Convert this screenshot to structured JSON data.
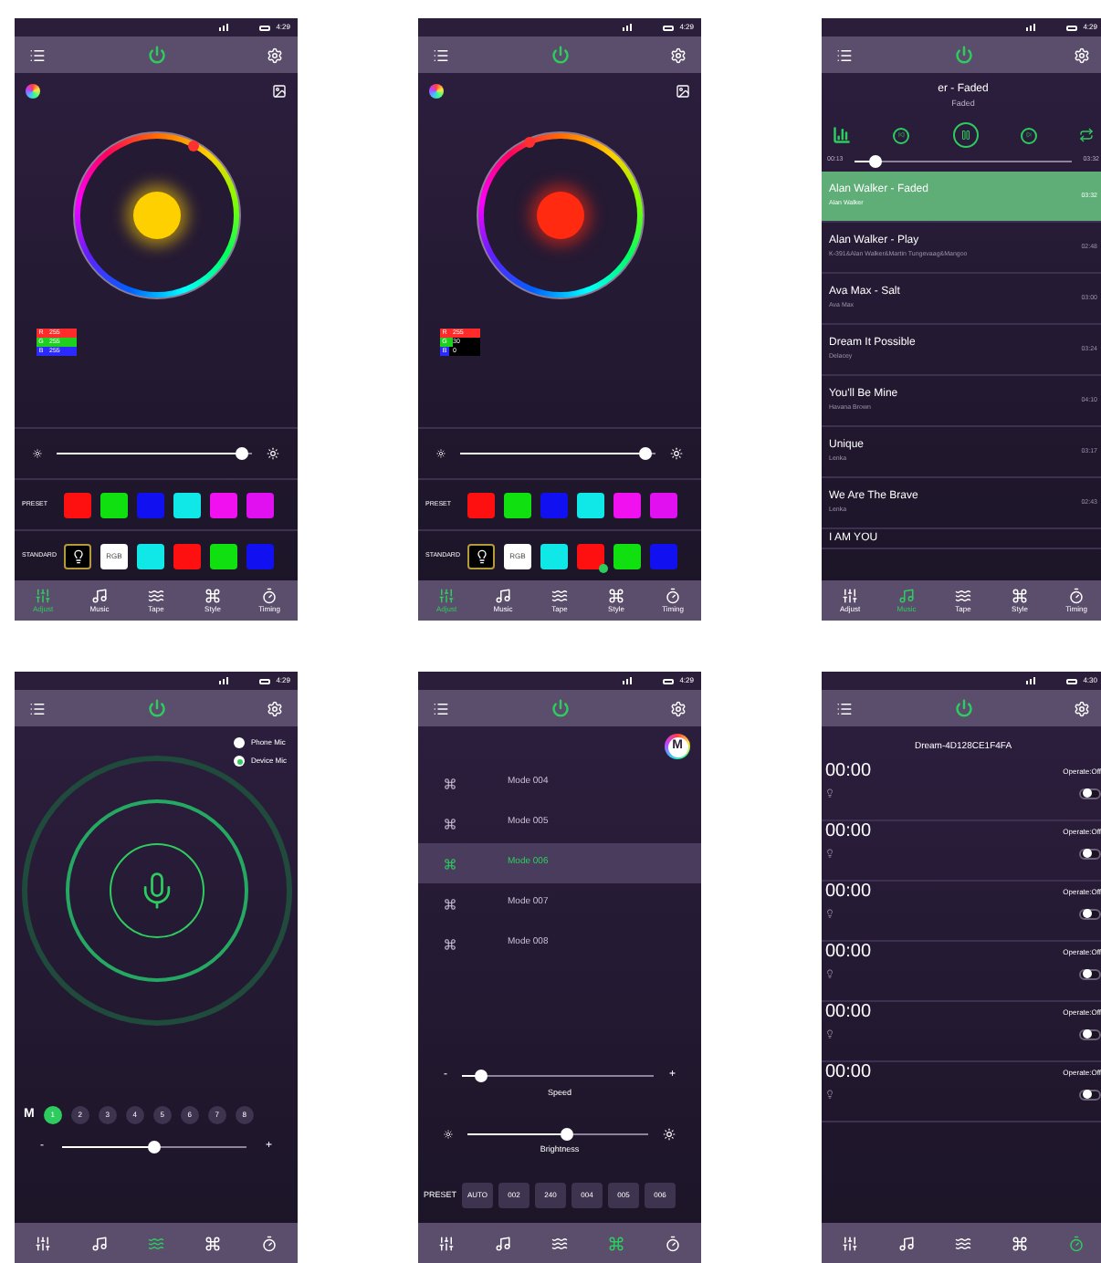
{
  "screens": [
    {
      "kind": "color",
      "status_bar": {
        "time": "4:29"
      },
      "wheel": {
        "color": "#ffd000"
      },
      "rgb": [
        {
          "label": "R",
          "value": "255",
          "level": 1,
          "color": "#ff2a2a"
        },
        {
          "label": "G",
          "value": "255",
          "level": 1,
          "color": "#1fcf1f"
        },
        {
          "label": "B",
          "value": "255",
          "level": 1,
          "color": "#2a2aff"
        }
      ],
      "brightness": {
        "level": 0.95
      },
      "preset": {
        "label": "PRESET",
        "swatches": [
          {
            "color": "#ff1010"
          },
          {
            "color": "#10e010"
          },
          {
            "color": "#1010f0"
          },
          {
            "color": "#10e8e8"
          },
          {
            "color": "#f010f0"
          },
          {
            "color": "#e010f0"
          }
        ]
      },
      "standard": {
        "label": "STANDARD",
        "items": [
          {
            "kind": "bulb",
            "selected": false
          },
          {
            "kind": "text",
            "text": "RGB",
            "selected": false
          },
          {
            "kind": "swatch",
            "color": "#10e8e8",
            "selected": false
          },
          {
            "kind": "swatch",
            "color": "#ff1010",
            "selected": false
          },
          {
            "kind": "swatch",
            "color": "#10e010",
            "selected": false
          },
          {
            "kind": "swatch",
            "color": "#1010f0",
            "selected": false
          }
        ]
      },
      "nav": [
        {
          "label": "Adjust",
          "selected": true
        },
        {
          "label": "Music",
          "selected": false
        },
        {
          "label": "Tape",
          "selected": false
        },
        {
          "label": "Style",
          "selected": false
        },
        {
          "label": "Timing",
          "selected": false
        }
      ]
    },
    {
      "kind": "color",
      "status_bar": {
        "time": "4:29"
      },
      "wheel": {
        "color": "#ff2a10"
      },
      "rgb": [
        {
          "label": "R",
          "value": "255",
          "level": 1,
          "color": "#ff2a2a"
        },
        {
          "label": "G",
          "value": "30",
          "level": 0.12,
          "color": "#1fcf1f"
        },
        {
          "label": "B",
          "value": "0",
          "level": 0,
          "color": "#2a2aff"
        }
      ],
      "brightness": {
        "level": 0.95
      },
      "preset": {
        "label": "PRESET",
        "swatches": [
          {
            "color": "#ff1010"
          },
          {
            "color": "#10e010"
          },
          {
            "color": "#1010f0"
          },
          {
            "color": "#10e8e8"
          },
          {
            "color": "#f010f0"
          },
          {
            "color": "#e010f0"
          }
        ]
      },
      "standard": {
        "label": "STANDARD",
        "items": [
          {
            "kind": "bulb",
            "selected": false
          },
          {
            "kind": "text",
            "text": "RGB",
            "selected": false
          },
          {
            "kind": "swatch",
            "color": "#10e8e8",
            "selected": false
          },
          {
            "kind": "swatch",
            "color": "#ff1010",
            "selected": true
          },
          {
            "kind": "swatch",
            "color": "#10e010",
            "selected": false
          },
          {
            "kind": "swatch",
            "color": "#1010f0",
            "selected": false
          }
        ]
      },
      "nav": [
        {
          "label": "Adjust",
          "selected": true
        },
        {
          "label": "Music",
          "selected": false
        },
        {
          "label": "Tape",
          "selected": false
        },
        {
          "label": "Style",
          "selected": false
        },
        {
          "label": "Timing",
          "selected": false
        }
      ]
    },
    {
      "kind": "music",
      "status_bar": {
        "time": "4:29"
      },
      "now_playing": {
        "title": "er - Faded",
        "subtitle": "Faded"
      },
      "progress": {
        "elapsed": "00:13",
        "total": "03:32",
        "level": 0.1
      },
      "songs": [
        {
          "title": "Alan Walker - Faded",
          "artist": "Alan Walker",
          "duration": "03:32",
          "selected": true
        },
        {
          "title": "Alan Walker - Play",
          "artist": "K-391&Alan Walker&Martin Tungevaag&Mangoo",
          "duration": "02:48",
          "selected": false
        },
        {
          "title": "Ava Max - Salt",
          "artist": "Ava Max",
          "duration": "03:00",
          "selected": false
        },
        {
          "title": "Dream It Possible",
          "artist": "Delacey",
          "duration": "03:24",
          "selected": false
        },
        {
          "title": "You'll Be Mine",
          "artist": "Havana Brown",
          "duration": "04:10",
          "selected": false
        },
        {
          "title": "Unique",
          "artist": "Lenka",
          "duration": "03:17",
          "selected": false
        },
        {
          "title": "We Are The Brave",
          "artist": "Lenka",
          "duration": "02:43",
          "selected": false
        },
        {
          "title": "I AM YOU",
          "selected": false
        }
      ],
      "nav": [
        {
          "label": "Adjust",
          "selected": false
        },
        {
          "label": "Music",
          "selected": true
        },
        {
          "label": "Tape",
          "selected": false
        },
        {
          "label": "Style",
          "selected": false
        },
        {
          "label": "Timing",
          "selected": false
        }
      ]
    },
    {
      "kind": "mic",
      "status_bar": {
        "time": "4:29"
      },
      "sources": [
        {
          "label": "Phone Mic",
          "selected": false
        },
        {
          "label": "Device Mic",
          "selected": true
        }
      ],
      "mode_label": "M",
      "modes": [
        {
          "label": "1",
          "selected": true
        },
        {
          "label": "2",
          "selected": false
        },
        {
          "label": "3",
          "selected": false
        },
        {
          "label": "4",
          "selected": false
        },
        {
          "label": "5",
          "selected": false
        },
        {
          "label": "6",
          "selected": false
        },
        {
          "label": "7",
          "selected": false
        },
        {
          "label": "8",
          "selected": false
        }
      ],
      "sensitivity": {
        "minus": "-",
        "plus": "+",
        "level": 0.5
      },
      "nav": [
        {
          "selected": false
        },
        {
          "selected": false
        },
        {
          "selected": true
        },
        {
          "selected": false
        },
        {
          "selected": false
        }
      ]
    },
    {
      "kind": "style",
      "status_bar": {
        "time": "4:29"
      },
      "badge": "M",
      "modes": [
        {
          "label": "Mode 004",
          "selected": false
        },
        {
          "label": "Mode 005",
          "selected": false
        },
        {
          "label": "Mode 006",
          "selected": true
        },
        {
          "label": "Mode 007",
          "selected": false
        },
        {
          "label": "Mode 008",
          "selected": false
        }
      ],
      "speed": {
        "label": "Speed",
        "minus": "-",
        "plus": "+",
        "level": 0.1
      },
      "brightness": {
        "label": "Brightness",
        "level": 0.55
      },
      "presets": {
        "label": "PRESET",
        "buttons": [
          "AUTO",
          "002",
          "240",
          "004",
          "005",
          "006"
        ]
      },
      "nav": [
        {
          "selected": false
        },
        {
          "selected": false
        },
        {
          "selected": false
        },
        {
          "selected": true
        },
        {
          "selected": false
        }
      ]
    },
    {
      "kind": "timer",
      "status_bar": {
        "time": "4:30"
      },
      "device": "Dream-4D128CE1F4FA",
      "timers": [
        {
          "time": "00:00",
          "operate": "Operate:Off",
          "on": false
        },
        {
          "time": "00:00",
          "operate": "Operate:Off",
          "on": false
        },
        {
          "time": "00:00",
          "operate": "Operate:Off",
          "on": false
        },
        {
          "time": "00:00",
          "operate": "Operate:Off",
          "on": false
        },
        {
          "time": "00:00",
          "operate": "Operate:Off",
          "on": false
        },
        {
          "time": "00:00",
          "operate": "Operate:Off",
          "on": false
        }
      ],
      "nav": [
        {
          "selected": false
        },
        {
          "selected": false
        },
        {
          "selected": false
        },
        {
          "selected": false
        },
        {
          "selected": true
        }
      ]
    }
  ]
}
